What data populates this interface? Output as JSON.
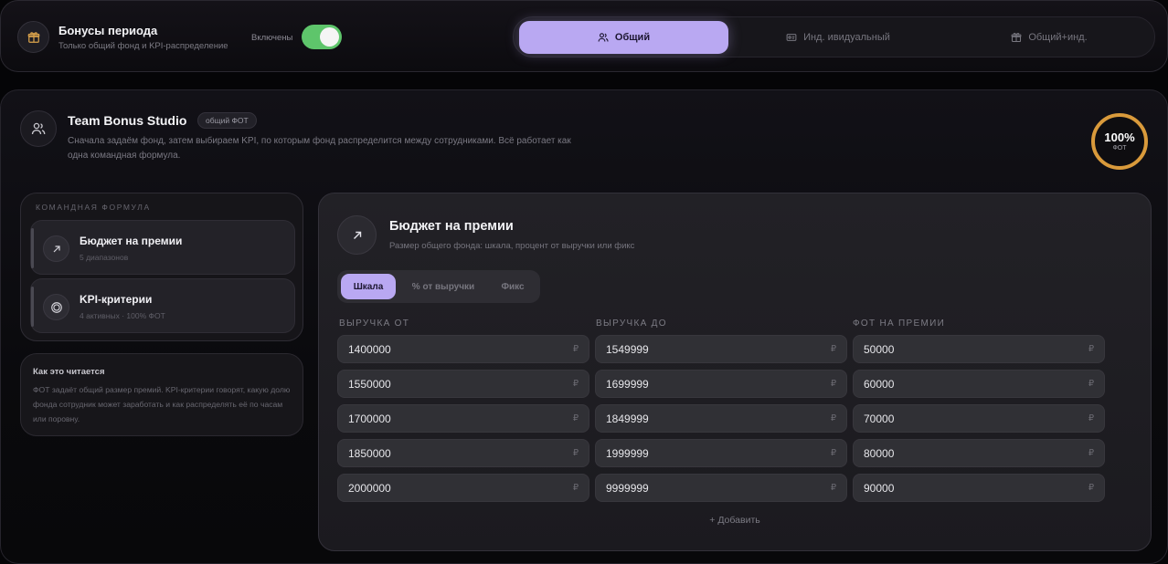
{
  "topbar": {
    "title": "Бонусы периода",
    "subtitle": "Только общий фонд и KPI-распределение",
    "toggle_label": "Включены",
    "toggle_on": true,
    "modes": [
      {
        "label": "Общий",
        "icon": "users-icon",
        "active": true
      },
      {
        "label": "Инд.  ивидуальный",
        "icon": "id-card-icon",
        "active": false
      },
      {
        "label": "Общий+инд.",
        "icon": "gift-icon",
        "active": false
      }
    ]
  },
  "team": {
    "title": "Team Bonus Studio",
    "badge": "общий ФОТ",
    "description": "Сначала задаём фонд, затем выбираем KPI, по которым фонд распределится между сотрудниками. Всё работает как одна командная формула.",
    "ring_value": "100%",
    "ring_label": "ФОТ",
    "ring_fraction": 1.0,
    "ring_color": "#d99a3b"
  },
  "formula": {
    "caption": "КОМАНДНАЯ ФОРМУЛА",
    "items": [
      {
        "title": "Бюджет на премии",
        "subtitle": "5 диапазонов",
        "icon": "arrow-up-right-icon"
      },
      {
        "title": "KPI-критерии",
        "subtitle": "4 активных · 100% ФОТ",
        "icon": "target-icon"
      }
    ]
  },
  "reading": {
    "title": "Как это читается",
    "text": "ФОТ задаёт общий размер премий. KPI-критерии говорят, какую долю фонда сотрудник может заработать и как распределять её по часам или поровну."
  },
  "budget": {
    "title": "Бюджет на премии",
    "subtitle": "Размер общего фонда: шкала, процент от выручки или фикс",
    "tabs": [
      {
        "label": "Шкала",
        "active": true
      },
      {
        "label": "% от выручки",
        "active": false
      },
      {
        "label": "Фикс",
        "active": false
      }
    ],
    "columns": [
      "ВЫРУЧКА ОТ",
      "ВЫРУЧКА ДО",
      "ФОТ НА ПРЕМИИ"
    ],
    "currency": "₽",
    "rows": [
      [
        "1400000",
        "1549999",
        "50000"
      ],
      [
        "1550000",
        "1699999",
        "60000"
      ],
      [
        "1700000",
        "1849999",
        "70000"
      ],
      [
        "1850000",
        "1999999",
        "80000"
      ],
      [
        "2000000",
        "9999999",
        "90000"
      ]
    ],
    "add_label": "+ Добавить"
  },
  "colors": {
    "accent": "#b9a8f2",
    "toggle": "#5ec56b",
    "ring": "#d99a3b"
  }
}
